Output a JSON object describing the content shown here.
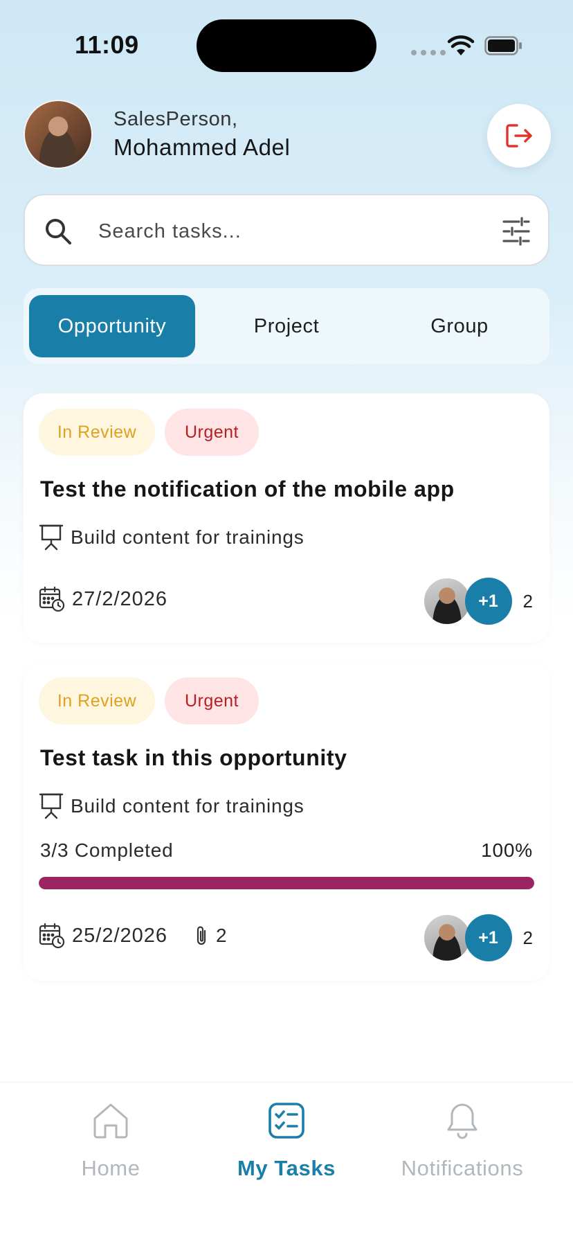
{
  "status_bar": {
    "time": "11:09"
  },
  "header": {
    "role": "SalesPerson,",
    "name": "Mohammed Adel"
  },
  "search": {
    "placeholder": "Search tasks..."
  },
  "tabs": [
    {
      "label": "Opportunity",
      "active": true
    },
    {
      "label": "Project",
      "active": false
    },
    {
      "label": "Group",
      "active": false
    }
  ],
  "tasks": [
    {
      "status": "In Review",
      "priority": "Urgent",
      "title": "Test the notification of the mobile app",
      "project": "Build content for trainings",
      "date": "27/2/2026",
      "extra_assignees": "+1",
      "assignee_count": "2"
    },
    {
      "status": "In Review",
      "priority": "Urgent",
      "title": "Test task in this opportunity",
      "project": "Build content for trainings",
      "progress_label": "3/3 Completed",
      "progress_percent": "100%",
      "progress_value": 1.0,
      "date": "25/2/2026",
      "attachments": "2",
      "extra_assignees": "+1",
      "assignee_count": "2"
    }
  ],
  "nav": [
    {
      "label": "Home",
      "icon": "home-icon",
      "active": false
    },
    {
      "label": "My Tasks",
      "icon": "tasks-icon",
      "active": true
    },
    {
      "label": "Notifications",
      "icon": "bell-icon",
      "active": false
    }
  ],
  "colors": {
    "accent": "#1a7fa8",
    "urgent_text": "#b62024",
    "review_text": "#e0a020",
    "progress": "#9b2562",
    "logout": "#e0352b"
  }
}
